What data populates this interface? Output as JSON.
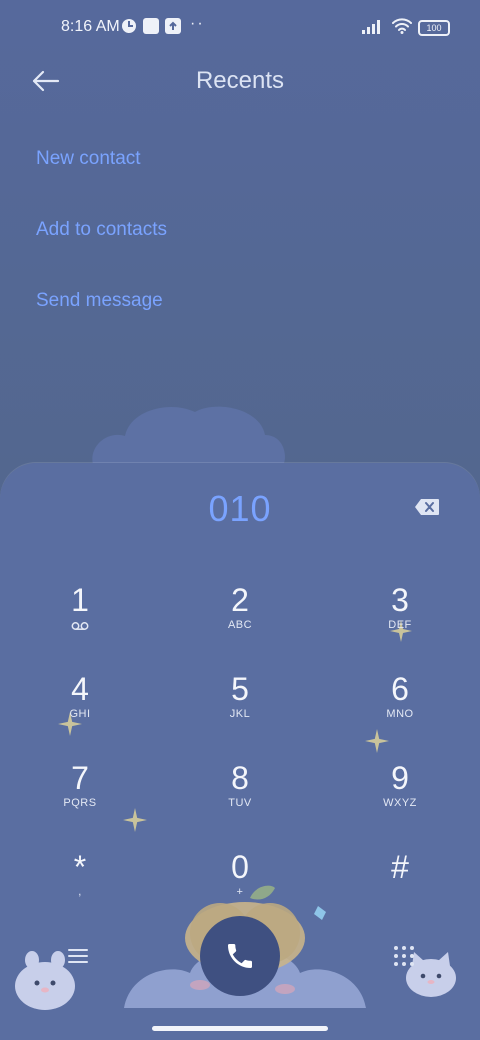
{
  "status_bar": {
    "time": "8:16 AM",
    "battery": "100"
  },
  "header": {
    "title": "Recents"
  },
  "actions": [
    {
      "label": "New contact"
    },
    {
      "label": "Add to contacts"
    },
    {
      "label": "Send message"
    }
  ],
  "dialer": {
    "number": "010",
    "keys": [
      {
        "digit": "1",
        "letters": ""
      },
      {
        "digit": "2",
        "letters": "ABC"
      },
      {
        "digit": "3",
        "letters": "DEF"
      },
      {
        "digit": "4",
        "letters": "GHI"
      },
      {
        "digit": "5",
        "letters": "JKL"
      },
      {
        "digit": "6",
        "letters": "MNO"
      },
      {
        "digit": "7",
        "letters": "PQRS"
      },
      {
        "digit": "8",
        "letters": "TUV"
      },
      {
        "digit": "9",
        "letters": "WXYZ"
      },
      {
        "digit": "*",
        "letters": ","
      },
      {
        "digit": "0",
        "letters": "+"
      },
      {
        "digit": "#",
        "letters": ""
      }
    ]
  },
  "icons": {
    "back": "arrow-left-icon",
    "backspace": "backspace-icon",
    "voicemail": "voicemail-icon",
    "call": "phone-icon",
    "menu": "menu-icon",
    "keypad": "keypad-icon"
  },
  "colors": {
    "accent": "#7aa3ff",
    "background": "#53678f",
    "panel": "#5a6ea1",
    "call_button": "#3f5081"
  }
}
